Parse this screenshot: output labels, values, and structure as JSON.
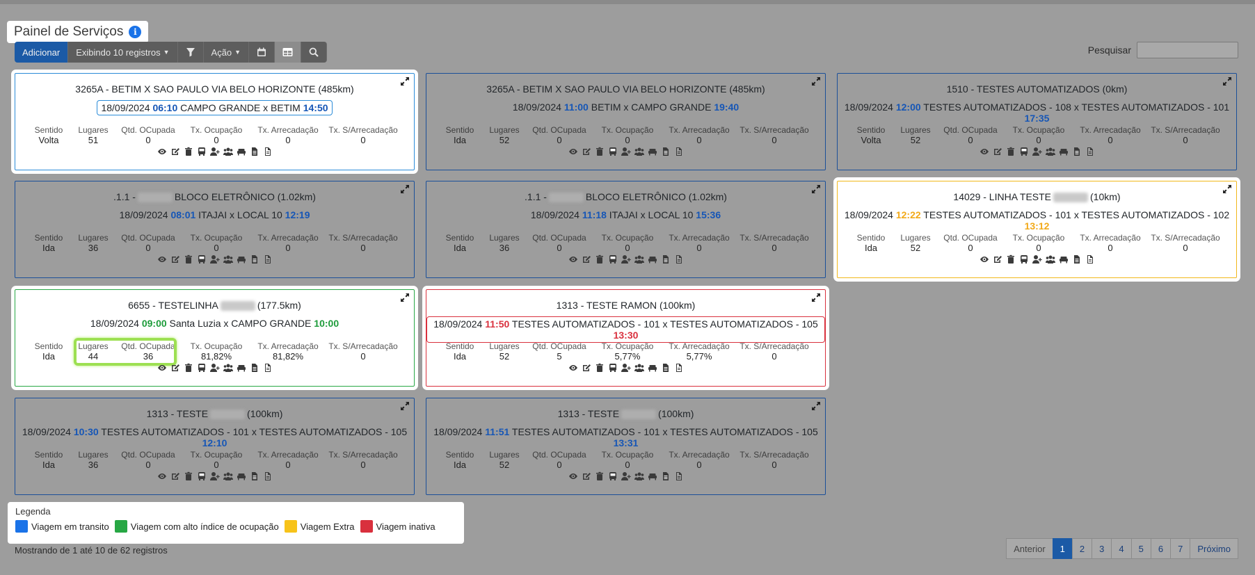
{
  "page": {
    "title": "Painel de Serviços",
    "search_label": "Pesquisar",
    "search_placeholder": ""
  },
  "toolbar": {
    "add": "Adicionar",
    "records": "Exibindo 10 registros",
    "action": "Ação"
  },
  "stat_labels": [
    "Sentido",
    "Lugares",
    "Qtd. OCupada",
    "Tx. Ocupação",
    "Tx. Arrecadação",
    "Tx. S/Arrecadação"
  ],
  "cards": [
    {
      "route_pre": "3265A - BETIM X SAO PAULO VIA BELO HORIZONTE (485km)",
      "route_post": "",
      "masked": false,
      "date": "18/09/2024",
      "dep": "06:10",
      "trip": "CAMPO GRANDE x BETIM",
      "arr": "14:50",
      "color": "blue",
      "stats": [
        "Volta",
        "51",
        "0",
        "0",
        "0",
        "0"
      ]
    },
    {
      "route_pre": "3265A - BETIM X SAO PAULO VIA BELO HORIZONTE (485km)",
      "route_post": "",
      "masked": false,
      "date": "18/09/2024",
      "dep": "11:00",
      "trip": "BETIM x CAMPO GRANDE",
      "arr": "19:40",
      "color": "none",
      "stats": [
        "Ida",
        "52",
        "0",
        "0",
        "0",
        "0"
      ]
    },
    {
      "route_pre": "1510 - TESTES AUTOMATIZADOS (0km)",
      "route_post": "",
      "masked": false,
      "date": "18/09/2024",
      "dep": "12:00",
      "trip": "TESTES AUTOMATIZADOS - 108 x TESTES AUTOMATIZADOS - 101",
      "arr": "17:35",
      "color": "none",
      "stats": [
        "Volta",
        "52",
        "0",
        "0",
        "0",
        "0"
      ]
    },
    {
      "route_pre": ".1.1 -",
      "route_post": "BLOCO ELETRÔNICO (1.02km)",
      "masked": true,
      "date": "18/09/2024",
      "dep": "08:01",
      "trip": "ITAJAI x LOCAL 10",
      "arr": "12:19",
      "color": "none",
      "stats": [
        "Ida",
        "36",
        "0",
        "0",
        "0",
        "0"
      ]
    },
    {
      "route_pre": ".1.1 -",
      "route_post": "BLOCO ELETRÔNICO (1.02km)",
      "masked": true,
      "date": "18/09/2024",
      "dep": "11:18",
      "trip": "ITAJAI x LOCAL 10",
      "arr": "15:36",
      "color": "none",
      "stats": [
        "Ida",
        "36",
        "0",
        "0",
        "0",
        "0"
      ]
    },
    {
      "route_pre": "14029 - LINHA TESTE",
      "route_post": "(10km)",
      "masked": true,
      "date": "18/09/2024",
      "dep": "12:22",
      "trip": "TESTES AUTOMATIZADOS - 101 x TESTES AUTOMATIZADOS - 102",
      "arr": "13:12",
      "color": "yellow",
      "stats": [
        "Ida",
        "52",
        "0",
        "0",
        "0",
        "0"
      ]
    },
    {
      "route_pre": "6655 - TESTELINHA",
      "route_post": "(177.5km)",
      "masked": true,
      "date": "18/09/2024",
      "dep": "09:00",
      "trip": "Santa Luzia x CAMPO GRANDE",
      "arr": "10:00",
      "color": "green",
      "stats": [
        "Ida",
        "44",
        "36",
        "81,82%",
        "81,82%",
        "0"
      ]
    },
    {
      "route_pre": "1313 - TESTE RAMON (100km)",
      "route_post": "",
      "masked": false,
      "date": "18/09/2024",
      "dep": "11:50",
      "trip": "TESTES AUTOMATIZADOS - 101 x TESTES AUTOMATIZADOS - 105",
      "arr": "13:30",
      "color": "red",
      "stats": [
        "Ida",
        "52",
        "5",
        "5,77%",
        "5,77%",
        "0"
      ]
    },
    {
      "route_pre": "1313 - TESTE",
      "route_post": "(100km)",
      "masked": true,
      "date": "18/09/2024",
      "dep": "10:30",
      "trip": "TESTES AUTOMATIZADOS - 101 x TESTES AUTOMATIZADOS - 105",
      "arr": "12:10",
      "color": "none",
      "stats": [
        "Ida",
        "36",
        "0",
        "0",
        "0",
        "0"
      ]
    },
    {
      "route_pre": "1313 - TESTE",
      "route_post": "(100km)",
      "masked": true,
      "date": "18/09/2024",
      "dep": "11:51",
      "trip": "TESTES AUTOMATIZADOS - 101 x TESTES AUTOMATIZADOS - 105",
      "arr": "13:31",
      "color": "none",
      "stats": [
        "Ida",
        "52",
        "0",
        "0",
        "0",
        "0"
      ]
    }
  ],
  "legend": {
    "title": "Legenda",
    "items": [
      {
        "label": "Viagem em transito",
        "color": "#1a73e8"
      },
      {
        "label": "Viagem com alto índice de ocupação",
        "color": "#27a744"
      },
      {
        "label": "Viagem Extra",
        "color": "#f7c31a"
      },
      {
        "label": "Viagem inativa",
        "color": "#d9303d"
      }
    ]
  },
  "footer": {
    "info": "Mostrando de 1 até 10 de 62 registros",
    "prev": "Anterior",
    "next": "Próximo",
    "pages": [
      "1",
      "2",
      "3",
      "4",
      "5",
      "6",
      "7"
    ],
    "current_page": "1"
  },
  "action_icons": [
    "view-icon",
    "edit-icon",
    "delete-icon",
    "bus-icon",
    "add-passenger-icon",
    "passengers-icon",
    "seat-icon",
    "document-icon",
    "report-icon"
  ]
}
